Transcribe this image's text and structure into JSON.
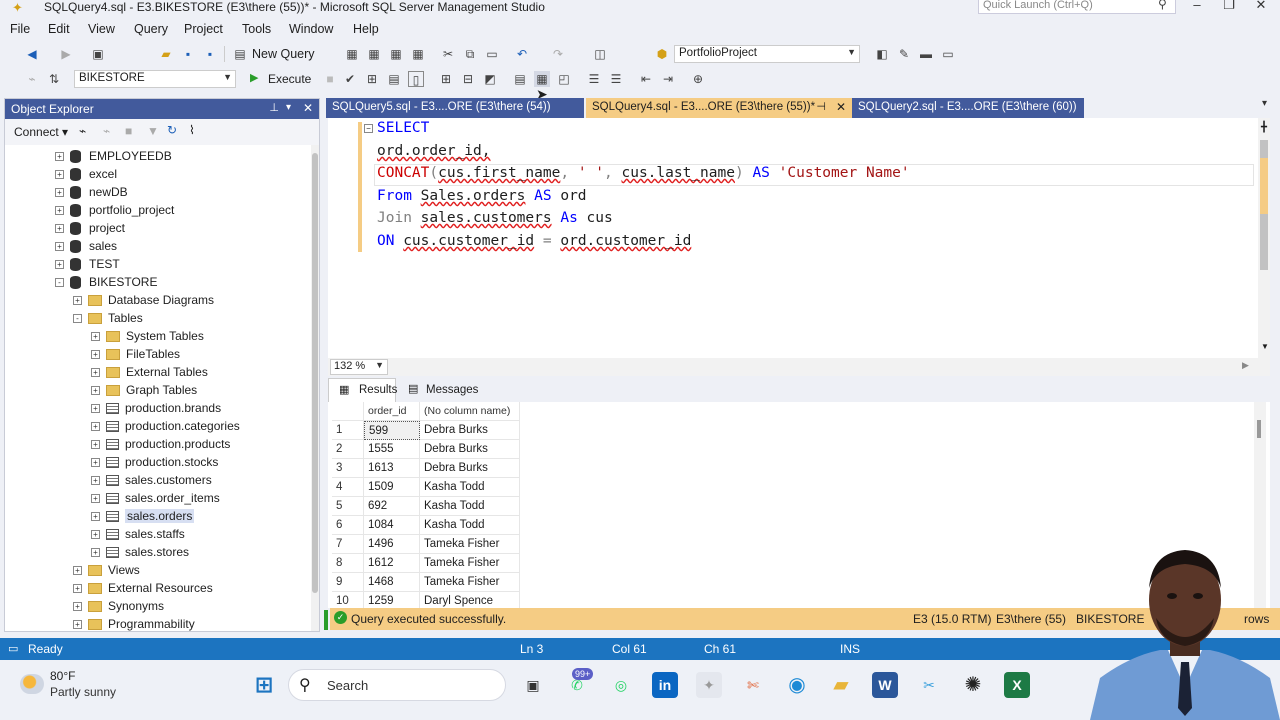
{
  "window": {
    "title": "SQLQuery4.sql - E3.BIKESTORE (E3\\there (55))* - Microsoft SQL Server Management Studio",
    "quick_launch": "Quick Launch (Ctrl+Q)"
  },
  "menu": [
    "File",
    "Edit",
    "View",
    "Query",
    "Project",
    "Tools",
    "Window",
    "Help"
  ],
  "toolbar": {
    "new_query": "New Query",
    "db_combo": "PortfolioProject",
    "db_selector": "BIKESTORE",
    "execute": "Execute"
  },
  "object_explorer": {
    "title": "Object Explorer",
    "connect": "Connect",
    "items": [
      {
        "label": "EMPLOYEEDB",
        "type": "db",
        "level": 0,
        "expand": "+"
      },
      {
        "label": "excel",
        "type": "db",
        "level": 0,
        "expand": "+"
      },
      {
        "label": "newDB",
        "type": "db",
        "level": 0,
        "expand": "+"
      },
      {
        "label": "portfolio_project",
        "type": "db",
        "level": 0,
        "expand": "+"
      },
      {
        "label": "project",
        "type": "db",
        "level": 0,
        "expand": "+"
      },
      {
        "label": "sales",
        "type": "db",
        "level": 0,
        "expand": "+"
      },
      {
        "label": "TEST",
        "type": "db",
        "level": 0,
        "expand": "+"
      },
      {
        "label": "BIKESTORE",
        "type": "db",
        "level": 0,
        "expand": "-"
      },
      {
        "label": "Database Diagrams",
        "type": "folder",
        "level": 1,
        "expand": "+"
      },
      {
        "label": "Tables",
        "type": "folder",
        "level": 1,
        "expand": "-"
      },
      {
        "label": "System Tables",
        "type": "folder",
        "level": 2,
        "expand": "+"
      },
      {
        "label": "FileTables",
        "type": "folder",
        "level": 2,
        "expand": "+"
      },
      {
        "label": "External Tables",
        "type": "folder",
        "level": 2,
        "expand": "+"
      },
      {
        "label": "Graph Tables",
        "type": "folder",
        "level": 2,
        "expand": "+"
      },
      {
        "label": "production.brands",
        "type": "table",
        "level": 2,
        "expand": "+"
      },
      {
        "label": "production.categories",
        "type": "table",
        "level": 2,
        "expand": "+"
      },
      {
        "label": "production.products",
        "type": "table",
        "level": 2,
        "expand": "+"
      },
      {
        "label": "production.stocks",
        "type": "table",
        "level": 2,
        "expand": "+"
      },
      {
        "label": "sales.customers",
        "type": "table",
        "level": 2,
        "expand": "+"
      },
      {
        "label": "sales.order_items",
        "type": "table",
        "level": 2,
        "expand": "+"
      },
      {
        "label": "sales.orders",
        "type": "table",
        "level": 2,
        "expand": "+",
        "selected": true
      },
      {
        "label": "sales.staffs",
        "type": "table",
        "level": 2,
        "expand": "+"
      },
      {
        "label": "sales.stores",
        "type": "table",
        "level": 2,
        "expand": "+"
      },
      {
        "label": "Views",
        "type": "folder",
        "level": 1,
        "expand": "+"
      },
      {
        "label": "External Resources",
        "type": "folder",
        "level": 1,
        "expand": "+"
      },
      {
        "label": "Synonyms",
        "type": "folder",
        "level": 1,
        "expand": "+"
      },
      {
        "label": "Programmability",
        "type": "folder",
        "level": 1,
        "expand": "+"
      }
    ]
  },
  "tabs": [
    {
      "label": "SQLQuery5.sql - E3....ORE (E3\\there (54))",
      "active": false
    },
    {
      "label": "SQLQuery4.sql - E3....ORE (E3\\there (55))*",
      "active": true
    },
    {
      "label": "SQLQuery2.sql - E3....ORE (E3\\there (60))",
      "active": false
    }
  ],
  "code": {
    "l1": "SELECT",
    "l2": "ord.order_id,",
    "l3_fn": "CONCAT",
    "l3_a": "(",
    "l3_b": "cus.first_name",
    "l3_c": ", ",
    "l3_d": "' '",
    "l3_e": ", ",
    "l3_f": "cus.last_name",
    "l3_g": ") ",
    "l3_h": "AS ",
    "l3_i": "'Customer Name'",
    "l4_kw": "From ",
    "l4_t": "Sales.orders",
    "l4_as": " AS ",
    "l4_a": "ord",
    "l5_kw": "Join ",
    "l5_t": "sales.customers",
    "l5_as": " As ",
    "l5_a": "cus",
    "l6_kw": "ON ",
    "l6_a": "cus.customer_id",
    "l6_eq": " = ",
    "l6_b": "ord.customer_id"
  },
  "zoom": "132 %",
  "results": {
    "tabs": [
      "Results",
      "Messages"
    ],
    "columns": [
      "order_id",
      "(No column name)"
    ],
    "rows": [
      [
        "1",
        "599",
        "Debra Burks"
      ],
      [
        "2",
        "1555",
        "Debra Burks"
      ],
      [
        "3",
        "1613",
        "Debra Burks"
      ],
      [
        "4",
        "1509",
        "Kasha Todd"
      ],
      [
        "5",
        "692",
        "Kasha Todd"
      ],
      [
        "6",
        "1084",
        "Kasha Todd"
      ],
      [
        "7",
        "1496",
        "Tameka Fisher"
      ],
      [
        "8",
        "1612",
        "Tameka Fisher"
      ],
      [
        "9",
        "1468",
        "Tameka Fisher"
      ],
      [
        "10",
        "1259",
        "Daryl Spence"
      ]
    ]
  },
  "query_status": {
    "message": "Query executed successfully.",
    "server": "E3 (15.0 RTM)",
    "user": "E3\\there (55)",
    "db": "BIKESTORE",
    "rows": "rows"
  },
  "status_bar": {
    "ready": "Ready",
    "ln": "Ln 3",
    "col": "Col 61",
    "ch": "Ch 61",
    "mode": "INS"
  },
  "taskbar": {
    "temp": "80°F",
    "weather": "Partly sunny",
    "search": "Search",
    "badge": "99+"
  },
  "colors": {
    "accent": "#425a9c",
    "tab_active": "#f5cc84",
    "status": "#1c74c0"
  }
}
